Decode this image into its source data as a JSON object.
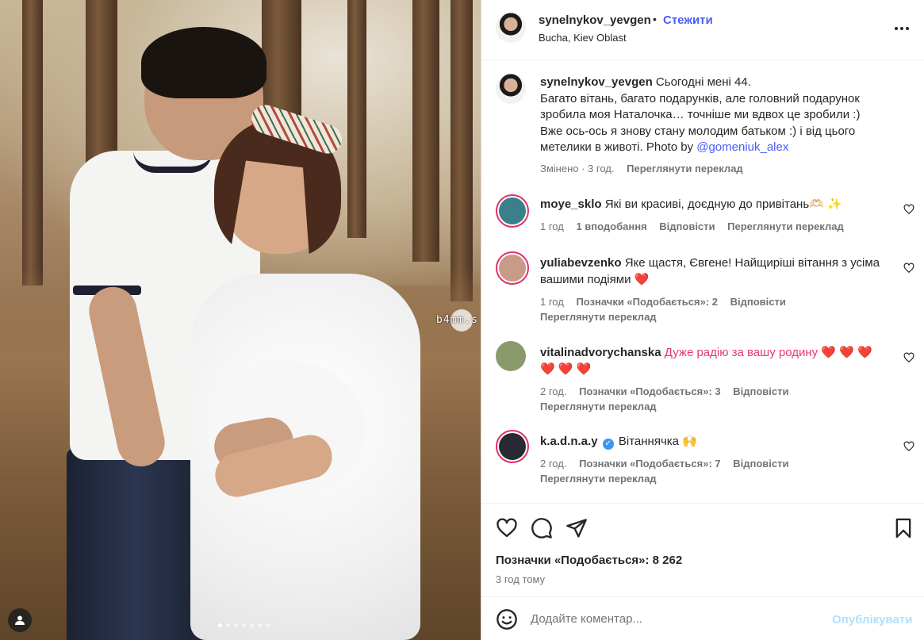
{
  "photo": {
    "watermark": "b4mm.s",
    "carousel_dots": 7,
    "active_dot": 0
  },
  "header": {
    "username": "synelnykov_yevgen",
    "separator": "•",
    "follow_label": "Стежити",
    "location": "Bucha, Kiev Oblast",
    "more_icon": "more-horizontal-icon"
  },
  "caption": {
    "username": "synelnykov_yevgen",
    "lines": [
      "Сьогодні мені 44.",
      "Багато вітань, багато подарунків, але головний подарунок",
      "зробила моя Наталочка… точніше ми вдвох це зробили :)",
      "Вже ось-ось я знову стану молодим батьком :) і від цього",
      "метелики в животі. Photo by "
    ],
    "mention": "@gomeniuk_alex",
    "edited": "Змінено · 3 год.",
    "translate": "Переглянути переклад"
  },
  "comments": [
    {
      "username": "moye_sklo",
      "text_lines": [
        "Які ви красиві, доєдную до привітань🫶🏻 ✨"
      ],
      "time": "1 год",
      "likes": "1 вподобання",
      "reply": "Відповісти",
      "translate": "Переглянути переклад",
      "avatar_color": "#3b7f8c"
    },
    {
      "username": "yuliabevzenko",
      "text_lines": [
        "Яке щастя, Євгене! Найщиріші вітання з усіма",
        "вашими подіями ❤️"
      ],
      "time": "1 год",
      "likes": "Позначки «Подобається»: 2",
      "reply": "Відповісти",
      "translate": "Переглянути переклад",
      "avatar_color": "#c99a86"
    },
    {
      "username": "vitalinadvorychanska",
      "text_lines": [
        "Дуже радію за вашу родину ❤️ ❤️ ❤️",
        "❤️ ❤️ ❤️"
      ],
      "time": "2 год.",
      "likes": "Позначки «Подобається»: 3",
      "reply": "Відповісти",
      "translate": "Переглянути переклад",
      "avatar_color": "#8a9a6a"
    },
    {
      "username": "k.a.d.n.a.y",
      "verified": true,
      "text_lines": [
        "Вітаннячка 🙌"
      ],
      "time": "2 год.",
      "likes": "Позначки «Подобається»: 7",
      "reply": "Відповісти",
      "translate": "Переглянути переклад",
      "avatar_color": "#2a2a35"
    }
  ],
  "actions": {
    "like_icon": "heart-icon",
    "comment_icon": "comment-bubble-icon",
    "share_icon": "paper-plane-icon",
    "save_icon": "bookmark-icon",
    "likes_label": "Позначки «Подобається»: 8 262",
    "time_ago": "3 год тому"
  },
  "comment_bar": {
    "emoji_icon": "smiley-icon",
    "placeholder": "Додайте коментар...",
    "post_label": "Опублікувати"
  },
  "colors": {
    "accent": "#4a5df9",
    "post_disabled": "#b2dffc",
    "meta_text": "#737373"
  }
}
